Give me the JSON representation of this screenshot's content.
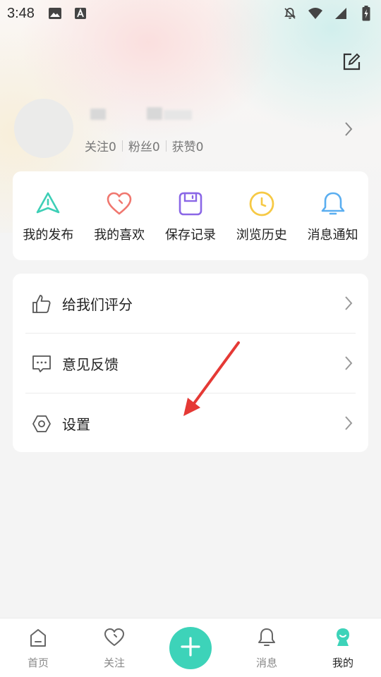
{
  "status_bar": {
    "time": "3:48",
    "left_icons": [
      "image-icon",
      "font-icon"
    ],
    "right_icons": [
      "bell-off-icon",
      "wifi-icon",
      "signal-icon",
      "battery-charging-icon"
    ]
  },
  "header": {
    "edit_icon": "edit-icon"
  },
  "profile": {
    "stats": [
      {
        "label": "关注0"
      },
      {
        "label": "粉丝0"
      },
      {
        "label": "获赞0"
      }
    ]
  },
  "quick_actions": [
    {
      "label": "我的发布",
      "icon": "publish-icon",
      "color": "#3dcfb6"
    },
    {
      "label": "我的喜欢",
      "icon": "heart-icon",
      "color": "#f0776f"
    },
    {
      "label": "保存记录",
      "icon": "save-icon",
      "color": "#8a67e6"
    },
    {
      "label": "浏览历史",
      "icon": "clock-icon",
      "color": "#f6c945"
    },
    {
      "label": "消息通知",
      "icon": "bell-icon",
      "color": "#5aaef0"
    }
  ],
  "menu": [
    {
      "label": "给我们评分",
      "icon": "thumbs-up-icon"
    },
    {
      "label": "意见反馈",
      "icon": "feedback-icon"
    },
    {
      "label": "设置",
      "icon": "settings-icon"
    }
  ],
  "tabbar": {
    "tabs": [
      {
        "label": "首页",
        "icon": "home-icon"
      },
      {
        "label": "关注",
        "icon": "heart-outline-icon"
      },
      {
        "label": "消息",
        "icon": "bell-outline-icon"
      },
      {
        "label": "我的",
        "icon": "profile-icon"
      }
    ],
    "active_tab": "我的",
    "accent": "#3dd3b9"
  },
  "annotation": {
    "arrow_color": "#e53935"
  }
}
